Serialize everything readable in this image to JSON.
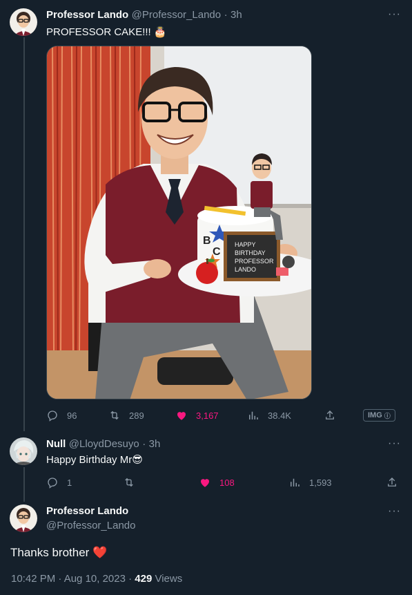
{
  "tweet1": {
    "name": "Professor Lando",
    "handle": "@Professor_Lando",
    "time": "3h",
    "text": "PROFESSOR CAKE!!! 🎂",
    "stats": {
      "replies": "96",
      "retweets": "289",
      "likes": "3,167",
      "views": "38.4K"
    },
    "img_badge": "IMG"
  },
  "tweet2": {
    "name": "Null",
    "handle": "@LloydDesuyo",
    "time": "3h",
    "text": "Happy Birthday Mr😎",
    "stats": {
      "replies": "1",
      "retweets": "",
      "likes": "108",
      "views": "1,593"
    }
  },
  "tweet3": {
    "name": "Professor Lando",
    "handle": "@Professor_Lando",
    "text": "Thanks brother ❤️",
    "timestamp": "10:42 PM · Aug 10, 2023 · ",
    "views_count": "429",
    "views_label": " Views"
  },
  "cake_sign": [
    "HAPPY",
    "BIRTHDAY",
    "PROFESSOR",
    "LANDO"
  ],
  "colors": {
    "background": "#15202b",
    "like_pink": "#f91880",
    "muted": "#8b98a5"
  }
}
